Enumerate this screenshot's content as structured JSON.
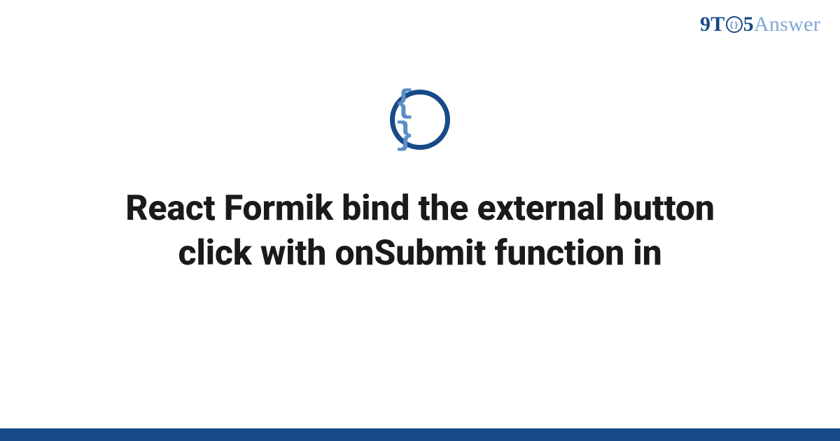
{
  "logo": {
    "prefix9": "9",
    "t": "T",
    "five": "5",
    "answer": "Answer",
    "braces": "{}"
  },
  "icon": {
    "name": "code-braces-icon",
    "glyph": "{ }"
  },
  "page": {
    "title": "React Formik bind the external button click with onSubmit function in"
  },
  "colors": {
    "primary": "#174a88",
    "accent": "#5a8ec6",
    "text": "#1a1a1a",
    "bg": "#ffffff"
  }
}
